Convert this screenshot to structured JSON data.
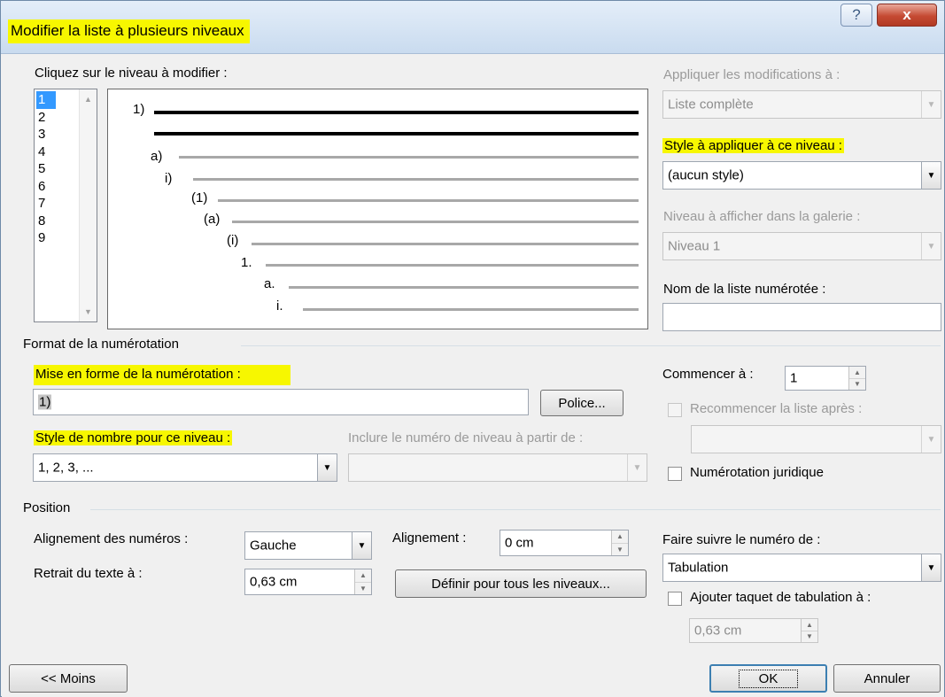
{
  "dialog": {
    "title": "Modifier la liste à plusieurs niveaux",
    "help_glyph": "?",
    "close_glyph": "x"
  },
  "levels": {
    "label": "Cliquez sur le niveau à modifier :",
    "items": [
      "1",
      "2",
      "3",
      "4",
      "5",
      "6",
      "7",
      "8",
      "9"
    ],
    "selected": "1"
  },
  "preview": {
    "numbers": [
      "1)",
      "a)",
      "i)",
      "(1)",
      "(a)",
      "(i)",
      "1.",
      "a.",
      "i."
    ]
  },
  "apply": {
    "label": "Appliquer les modifications à :",
    "value": "Liste complète"
  },
  "style_level": {
    "label": "Style à appliquer à ce niveau :",
    "value": "(aucun style)"
  },
  "gallery_level": {
    "label": "Niveau à afficher dans la galerie :",
    "value": "Niveau 1"
  },
  "list_name": {
    "label": "Nom de la liste numérotée :",
    "value": ""
  },
  "numbering": {
    "section": "Format de la numérotation",
    "format_label": "Mise en forme de la numérotation :",
    "format_value": "1)",
    "font_button": "Police...",
    "number_style_label": "Style de nombre pour ce niveau :",
    "number_style_value": "1, 2, 3, ...",
    "include_label": "Inclure le numéro de niveau à partir de :",
    "include_value": "",
    "start_label": "Commencer à :",
    "start_value": "1",
    "restart_label": "Recommencer la liste après :",
    "restart_value": "",
    "legal_label": "Numérotation juridique"
  },
  "position": {
    "section": "Position",
    "alignment_label": "Alignement des numéros :",
    "alignment_value": "Gauche",
    "at_label": "Alignement :",
    "at_value": "0 cm",
    "indent_label": "Retrait du texte à :",
    "indent_value": "0,63 cm",
    "all_levels_button": "Définir pour tous les niveaux...",
    "follow_label": "Faire suivre le numéro de :",
    "follow_value": "Tabulation",
    "tab_stop_label": "Ajouter taquet de tabulation à :",
    "tab_stop_value": "0,63 cm"
  },
  "footer": {
    "less_button": "<< Moins",
    "ok_button": "OK",
    "cancel_button": "Annuler"
  },
  "colors": {
    "highlight": "#f7f700",
    "selection": "#3399ff",
    "default_button_border": "#3c7fb1"
  }
}
